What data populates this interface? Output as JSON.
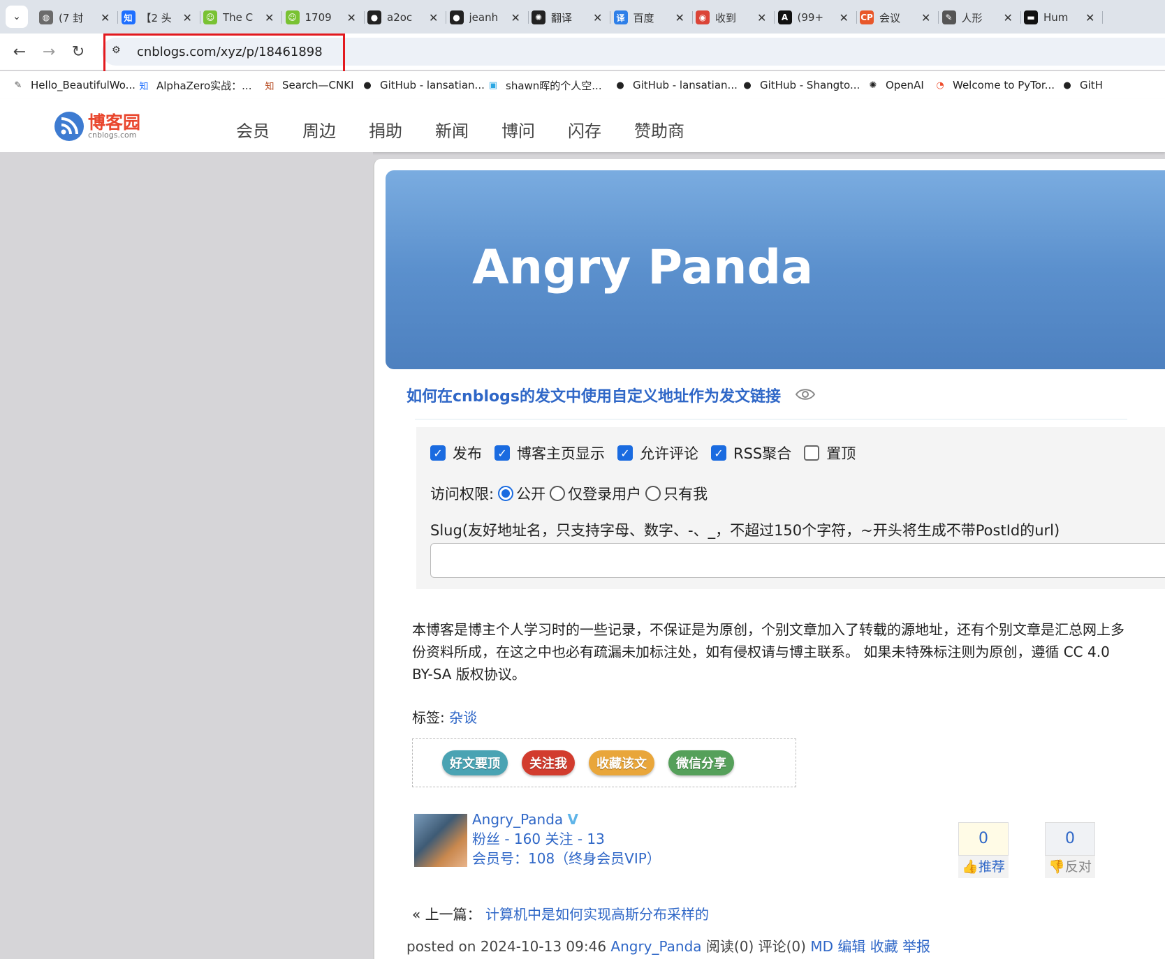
{
  "browser": {
    "tabs": [
      {
        "title": "(7 封",
        "icon": "globe-icon",
        "color": "#6b6b6b"
      },
      {
        "title": "【2 头",
        "icon": "zhihu-icon",
        "color": "#1e6fff"
      },
      {
        "title": "The C",
        "icon": "smiley-icon",
        "color": "#79c233"
      },
      {
        "title": "1709",
        "icon": "smiley-icon",
        "color": "#79c233"
      },
      {
        "title": "a2oc",
        "icon": "github-icon",
        "color": "#222222"
      },
      {
        "title": "jeanh",
        "icon": "github-icon",
        "color": "#222222"
      },
      {
        "title": "翻译",
        "icon": "openai-icon",
        "color": "#222222"
      },
      {
        "title": "百度",
        "icon": "baidu-translate-icon",
        "color": "#2e7fe8"
      },
      {
        "title": "收到",
        "icon": "chrome-icon",
        "color": "#db4437"
      },
      {
        "title": "(99+",
        "icon": "font-a-icon",
        "color": "#111111"
      },
      {
        "title": "会议",
        "icon": "cp-icon",
        "color": "#e8572a"
      },
      {
        "title": "人形",
        "icon": "feather-icon",
        "color": "#555555"
      },
      {
        "title": "Hum",
        "icon": "dark-square-icon",
        "color": "#111111"
      }
    ],
    "url": "cnblogs.com/xyz/p/18461898",
    "bookmarks": [
      {
        "label": "Hello_BeautifulWo...",
        "icon": "feather-icon"
      },
      {
        "label": "AlphaZero实战：...",
        "icon": "zhihu-icon"
      },
      {
        "label": "Search—CNKI",
        "icon": "cnki-icon"
      },
      {
        "label": "GitHub - lansatian...",
        "icon": "github-icon"
      },
      {
        "label": "shawn晖的个人空...",
        "icon": "bilibili-icon"
      },
      {
        "label": "GitHub - lansatian...",
        "icon": "github-icon"
      },
      {
        "label": "GitHub - Shangto...",
        "icon": "github-icon"
      },
      {
        "label": "OpenAI",
        "icon": "openai-icon"
      },
      {
        "label": "Welcome to PyTor...",
        "icon": "pytorch-icon"
      },
      {
        "label": "GitH",
        "icon": "github-icon"
      }
    ]
  },
  "site": {
    "logo_cn": "博客园",
    "logo_en": "cnblogs.com",
    "nav": [
      "会员",
      "周边",
      "捐助",
      "新闻",
      "博问",
      "闪存",
      "赞助商"
    ]
  },
  "blog": {
    "banner_title": "Angry Panda",
    "post_title": "如何在cnblogs的发文中使用自定义地址作为发文链接",
    "options": [
      {
        "label": "发布",
        "checked": true
      },
      {
        "label": "博客主页显示",
        "checked": true
      },
      {
        "label": "允许评论",
        "checked": true
      },
      {
        "label": "RSS聚合",
        "checked": true
      },
      {
        "label": "置顶",
        "checked": false
      }
    ],
    "access_label": "访问权限:",
    "access_options": [
      {
        "label": "公开",
        "selected": true
      },
      {
        "label": "仅登录用户",
        "selected": false
      },
      {
        "label": "只有我",
        "selected": false
      }
    ],
    "slug_label": "Slug(友好地址名，只支持字母、数字、-、_，不超过150个字符，~开头将生成不带PostId的url)",
    "slug_value": "",
    "notice": "本博客是博主个人学习时的一些记录，不保证是为原创，个别文章加入了转载的源地址，还有个别文章是汇总网上多份资料所成，在这之中也必有疏漏未加标注处，如有侵权请与博主联系。 如果未特殊标注则为原创，遵循 CC 4.0 BY-SA 版权协议。",
    "tags_label": "标签:",
    "tag": "杂谈",
    "share_buttons": [
      {
        "label": "好文要顶",
        "color": "#4aa3b3"
      },
      {
        "label": "关注我",
        "color": "#d23c2e"
      },
      {
        "label": "收藏该文",
        "color": "#e9a63a"
      },
      {
        "label": "微信分享",
        "color": "#55a05a"
      }
    ],
    "author": {
      "name": "Angry_Panda",
      "verified_mark": "V",
      "stats": "粉丝 - 160 关注 - 13",
      "membership": "会员号：108（终身会员VIP）"
    },
    "votes": {
      "up_count": "0",
      "up_label": "推荐",
      "down_count": "0",
      "down_label": "反对"
    },
    "prev_label": "« 上一篇：",
    "prev_title": "计算机中是如何实现高斯分布采样的",
    "footer": {
      "posted": "posted on 2024-10-13 09:46",
      "author": "Angry_Panda",
      "reads": "阅读(0)",
      "comments": "评论(0)",
      "md": "MD",
      "edit": "编辑",
      "favorite": "收藏",
      "report": "举报"
    }
  }
}
